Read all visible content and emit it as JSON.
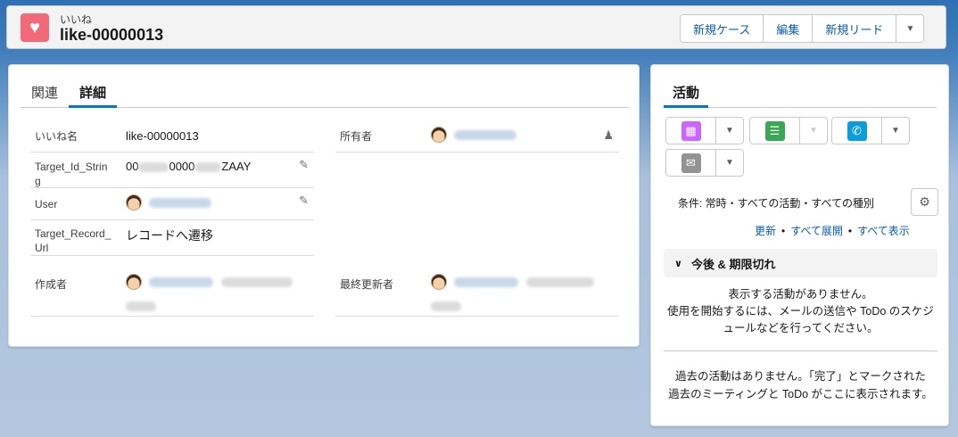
{
  "header": {
    "object_type": "いいね",
    "record_name": "like-00000013",
    "buttons": [
      "新規ケース",
      "編集",
      "新規リード"
    ],
    "icon": "heart-icon"
  },
  "detail": {
    "tabs": [
      "関連",
      "詳細"
    ],
    "active_tab": "詳細",
    "fields": {
      "name_label": "いいね名",
      "name_value": "like-00000013",
      "owner_label": "所有者",
      "target_id_label": "Target_Id_String",
      "target_id_value_a": "00",
      "target_id_value_b": "0000",
      "target_id_value_c": "ZAAY",
      "user_label": "User",
      "target_url_label": "Target_Record_Url",
      "target_url_value": "レコードへ遷移",
      "created_label": "作成者",
      "modified_label": "最終更新者"
    }
  },
  "activity": {
    "tab": "活動",
    "filter_text": "条件: 常時・すべての活動・すべての種別",
    "links": [
      "更新",
      "すべて展開",
      "すべて表示"
    ],
    "section_title": "今後 & 期限切れ",
    "empty_line1": "表示する活動がありません。",
    "empty_line2": "使用を開始するには、メールの送信や ToDo のスケジ",
    "empty_line3": "ュールなどを行ってください。",
    "past_line1": "過去の活動はありません。「完了」とマークされた",
    "past_line2": "過去のミーティングと ToDo がここに表示されます。",
    "colors": {
      "event": "#cb65ff",
      "task": "#3ba755",
      "call": "#0d9dda",
      "email": "#939393"
    }
  }
}
